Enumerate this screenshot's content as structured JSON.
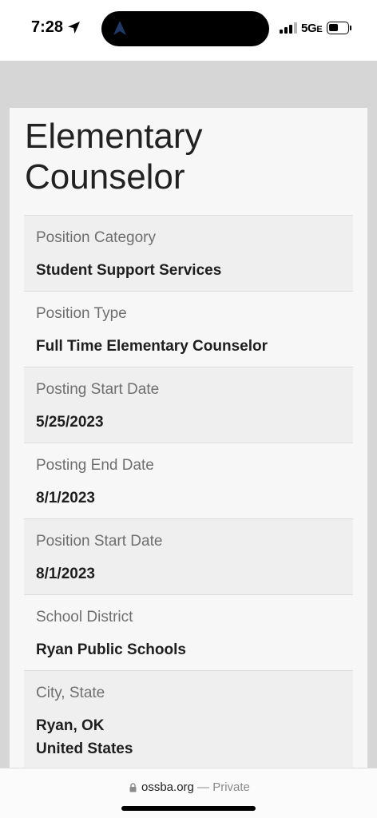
{
  "status_bar": {
    "time": "7:28",
    "network": "5G",
    "network_suffix": "E",
    "battery_level": 0.5
  },
  "page": {
    "title_line1": "Elementary",
    "title_line2": "Counselor"
  },
  "details": [
    {
      "label": "Position Category",
      "value": "Student Support Services"
    },
    {
      "label": "Position Type",
      "value": "Full Time Elementary Counselor"
    },
    {
      "label": "Posting Start Date",
      "value": "5/25/2023"
    },
    {
      "label": "Posting End Date",
      "value": "8/1/2023"
    },
    {
      "label": "Position Start Date",
      "value": "8/1/2023"
    },
    {
      "label": "School District",
      "value": "Ryan Public Schools"
    },
    {
      "label": "City, State",
      "value": "Ryan, OK",
      "value2": "United States"
    }
  ],
  "browser": {
    "domain": "ossba.org",
    "mode": "— Private"
  },
  "colors": {
    "background": "#d6d6d6",
    "card": "#f7f7f7",
    "row_shaded": "#efefef",
    "label": "#6f6f6f",
    "value": "#1e1e1e"
  }
}
